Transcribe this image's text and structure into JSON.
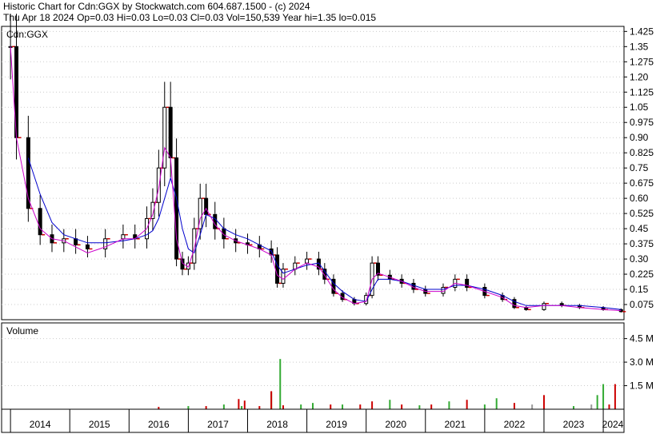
{
  "header": {
    "line1": "Historic Chart for Cdn:GGX by Stockwatch.com 604.687.1500 - (c) 2024",
    "line2": "Thu Apr 18 2024  Op=0.03  Hi=0.03  Lo=0.03  Cl=0.03  Vol=150,539  Year hi=1.35  lo=0.015"
  },
  "chart_data": [
    {
      "type": "candlestick",
      "panel_label": "Cdn:GGX",
      "ylim": [
        0.0,
        1.45
      ],
      "y_ticks": [
        "1.425",
        "1.35",
        "1.275",
        "1.20",
        "1.125",
        "1.05",
        "0.975",
        "0.90",
        "0.825",
        "0.75",
        "0.675",
        "0.60",
        "0.525",
        "0.45",
        "0.375",
        "0.30",
        "0.225",
        "0.15",
        "0.075"
      ],
      "y_tick_values": [
        1.425,
        1.35,
        1.275,
        1.2,
        1.125,
        1.05,
        0.975,
        0.9,
        0.825,
        0.75,
        0.675,
        0.6,
        0.525,
        0.45,
        0.375,
        0.3,
        0.225,
        0.15,
        0.075
      ],
      "x": [
        2014.0,
        2014.1,
        2014.3,
        2014.5,
        2014.7,
        2014.9,
        2015.1,
        2015.3,
        2015.6,
        2015.9,
        2016.1,
        2016.3,
        2016.4,
        2016.5,
        2016.6,
        2016.7,
        2016.8,
        2016.9,
        2017.0,
        2017.1,
        2017.2,
        2017.3,
        2017.45,
        2017.6,
        2017.8,
        2018.0,
        2018.2,
        2018.4,
        2018.5,
        2018.6,
        2018.8,
        2019.0,
        2019.2,
        2019.3,
        2019.45,
        2019.6,
        2019.8,
        2020.0,
        2020.1,
        2020.2,
        2020.4,
        2020.6,
        2020.8,
        2021.0,
        2021.3,
        2021.5,
        2021.7,
        2022.0,
        2022.3,
        2022.5,
        2022.7,
        2023.0,
        2023.3,
        2023.6,
        2024.0,
        2024.3
      ],
      "close": [
        1.35,
        0.9,
        0.55,
        0.42,
        0.38,
        0.4,
        0.37,
        0.35,
        0.4,
        0.42,
        0.4,
        0.5,
        0.58,
        0.75,
        1.05,
        0.8,
        0.3,
        0.25,
        0.28,
        0.45,
        0.6,
        0.52,
        0.45,
        0.4,
        0.38,
        0.37,
        0.35,
        0.32,
        0.18,
        0.25,
        0.28,
        0.3,
        0.25,
        0.2,
        0.13,
        0.1,
        0.08,
        0.12,
        0.28,
        0.22,
        0.2,
        0.18,
        0.15,
        0.13,
        0.16,
        0.2,
        0.16,
        0.12,
        0.1,
        0.06,
        0.05,
        0.08,
        0.07,
        0.06,
        0.05,
        0.04
      ],
      "series": [
        {
          "name": "",
          "color": "#0000cc",
          "values": [
            null,
            null,
            0.8,
            0.62,
            0.48,
            0.42,
            0.4,
            0.38,
            0.38,
            0.39,
            0.4,
            0.42,
            0.44,
            0.5,
            0.6,
            0.7,
            0.6,
            0.45,
            0.35,
            0.33,
            0.42,
            0.52,
            0.5,
            0.45,
            0.42,
            0.4,
            0.37,
            0.34,
            0.27,
            0.23,
            0.25,
            0.27,
            0.28,
            0.24,
            0.18,
            0.14,
            0.1,
            0.09,
            0.15,
            0.2,
            0.2,
            0.19,
            0.17,
            0.15,
            0.15,
            0.17,
            0.17,
            0.15,
            0.12,
            0.09,
            0.07,
            0.07,
            0.07,
            0.07,
            0.06,
            0.05
          ]
        },
        {
          "name": "",
          "color": "#cc00cc",
          "values": [
            1.35,
            0.9,
            0.6,
            0.45,
            0.4,
            0.39,
            0.36,
            0.33,
            0.36,
            0.4,
            0.4,
            0.45,
            0.52,
            0.65,
            0.85,
            0.8,
            0.4,
            0.28,
            0.26,
            0.35,
            0.5,
            0.55,
            0.47,
            0.42,
            0.39,
            0.37,
            0.35,
            0.32,
            0.22,
            0.2,
            0.25,
            0.28,
            0.26,
            0.22,
            0.15,
            0.11,
            0.08,
            0.09,
            0.2,
            0.23,
            0.21,
            0.19,
            0.16,
            0.14,
            0.14,
            0.18,
            0.17,
            0.14,
            0.11,
            0.07,
            0.06,
            0.07,
            0.07,
            0.06,
            0.05,
            0.045
          ]
        }
      ]
    },
    {
      "type": "bar",
      "panel_label": "Volume",
      "ylim": [
        0,
        5.5
      ],
      "y_ticks": [
        "4.5 M",
        "3.0 M",
        "1.5 M"
      ],
      "y_tick_values": [
        4.5,
        3.0,
        1.5
      ],
      "x": [
        2016.5,
        2017.0,
        2017.3,
        2017.6,
        2017.9,
        2018.2,
        2018.4,
        2018.6,
        2018.9,
        2019.1,
        2019.4,
        2019.6,
        2019.9,
        2020.1,
        2020.4,
        2020.6,
        2020.9,
        2021.1,
        2021.4,
        2021.7,
        2022.0,
        2022.2,
        2022.5,
        2022.8,
        2023.0,
        2023.5,
        2023.8,
        2023.9,
        2024.0,
        2024.1,
        2024.2
      ],
      "values": [
        0.15,
        0.2,
        0.2,
        0.3,
        0.2,
        0.2,
        1.1,
        0.25,
        0.3,
        0.4,
        0.3,
        0.3,
        0.3,
        0.5,
        0.6,
        0.3,
        0.25,
        0.3,
        0.5,
        0.6,
        0.3,
        0.7,
        0.4,
        0.3,
        0.9,
        0.2,
        0.3,
        0.9,
        1.6,
        0.3,
        1.6
      ],
      "colors": [
        "#cc0000",
        "#33aa33",
        "#cc0000",
        "#33aa33",
        "#33aa33",
        "#cc0000",
        "#33aa33",
        "#cc0000",
        "#33aa33",
        "#33aa33",
        "#cc0000",
        "#33aa33",
        "#cc0000",
        "#cc0000",
        "#33aa33",
        "#cc0000",
        "#33aa33",
        "#cc0000",
        "#33aa33",
        "#cc0000",
        "#33aa33",
        "#33aa33",
        "#cc0000",
        "#999999",
        "#cc0000",
        "#33aa33",
        "#999999",
        "#33aa33",
        "#33aa33",
        "#cc0000",
        "#cc0000"
      ],
      "peak_bars": [
        {
          "x": 2018.55,
          "value": 3.2,
          "color": "#33aa33"
        },
        {
          "x": 2018.4,
          "value": 1.15,
          "color": "#cc0000"
        },
        {
          "x": 2017.85,
          "value": 0.65,
          "color": "#cc0000"
        },
        {
          "x": 2017.95,
          "value": 0.55,
          "color": "#cc0000"
        }
      ]
    }
  ],
  "x_axis": {
    "labels": [
      "2014",
      "2015",
      "2016",
      "2017",
      "2018",
      "2019",
      "2020",
      "2021",
      "2022",
      "2023",
      "2024"
    ],
    "values": [
      2014,
      2015,
      2016,
      2017,
      2018,
      2019,
      2020,
      2021,
      2022,
      2023,
      2024
    ]
  },
  "colors": {
    "candle": "#000000",
    "ma_long": "#0000cc",
    "ma_short": "#cc00cc",
    "down": "#cc0000",
    "up": "#33aa33"
  }
}
